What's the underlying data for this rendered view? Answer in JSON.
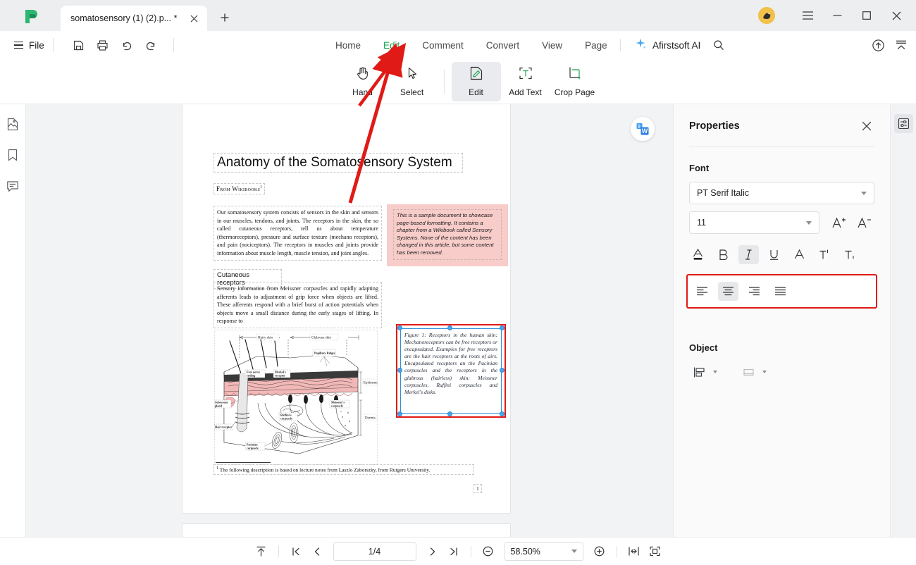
{
  "titlebar": {
    "logo_icon": "afirstsoft-logo-icon",
    "tab_title": "somatosensory (1) (2).p... *",
    "tab_close_icon": "close-icon",
    "new_tab_icon": "plus-icon",
    "avatar_icon": "user-avatar",
    "menu_icon": "hamburger-icon",
    "minimize_icon": "minimize-icon",
    "maximize_icon": "maximize-icon",
    "close_icon": "close-icon"
  },
  "menubar": {
    "file_label": "File",
    "quick_actions": [
      {
        "name": "save-as-button",
        "icon": "save-icon"
      },
      {
        "name": "print-button",
        "icon": "print-icon"
      },
      {
        "name": "undo-button",
        "icon": "undo-icon"
      },
      {
        "name": "redo-button",
        "icon": "redo-icon"
      }
    ],
    "tabs": [
      {
        "label": "Home",
        "active": false
      },
      {
        "label": "Edit",
        "active": true
      },
      {
        "label": "Comment",
        "active": false
      },
      {
        "label": "Convert",
        "active": false
      },
      {
        "label": "View",
        "active": false
      },
      {
        "label": "Page",
        "active": false
      }
    ],
    "ai_label": "Afirstsoft AI",
    "ai_icon": "sparkle-icon",
    "search_icon": "search-icon",
    "cloud_upload_icon": "cloud-upload-icon",
    "collapse_icon": "collapse-ribbon-icon",
    "accent_color": "#16a34a"
  },
  "ribbon": {
    "tools": [
      {
        "label": "Hand",
        "icon": "hand-icon",
        "active": false
      },
      {
        "label": "Select",
        "icon": "cursor-icon",
        "active": false
      },
      {
        "label": "Edit",
        "icon": "edit-page-icon",
        "active": true
      },
      {
        "label": "Add Text",
        "icon": "add-text-icon",
        "active": false
      },
      {
        "label": "Crop Page",
        "icon": "crop-page-icon",
        "active": false
      }
    ]
  },
  "left_rail": [
    {
      "name": "sidebar-thumbnails",
      "icon": "thumbnail-icon"
    },
    {
      "name": "sidebar-bookmarks",
      "icon": "bookmark-icon"
    },
    {
      "name": "sidebar-comments",
      "icon": "comment-icon"
    }
  ],
  "document": {
    "word_badge_icon": "convert-to-word-icon",
    "title": "Anatomy of the Somatosensory System",
    "from_line": "From Wikibooks",
    "from_sup": "1",
    "paragraph1": "Our somatosensory system consists of sensors in the skin and sensors in our muscles, tendons, and joints. The receptors in the skin, the so called cutaneous receptors, tell us about temperature (thermoreceptors), pressure and surface texture (mechano receptors), and pain (nociceptors). The receptors in muscles and joints provide information about muscle length, muscle tension, and joint angles.",
    "pink_note": "This is a sample document to showcase page-based formatting. It contains a chapter from a Wikibook called Sensory Systems. None of the content has been changed in this article, but some content has been removed.",
    "heading2": "Cutaneous receptors",
    "paragraph2": "Sensory information from Meissner corpuscles and rapidly adapting afferents leads to adjustment of grip force when objects are lifted. These afferents respond with a brief burst of action potentials when objects move a small distance during the early stages of lifting. In response to",
    "figure_caption": "Figure 1: Receptors in the human skin: Mechanoreceptors can be free receptors or encapsulated. Examples for free receptors are the hair receptors at the roots of airs. Encapsulated receptors an the Pacinian corpuscles and the receptors in the glabrous (hairless) skin: Meissner corpuscles, Ruffini corpuscles and Merkel's disks.",
    "figure_labels": {
      "hairy_skin": "Hairy skin",
      "glabrous_skin": "Glabrous skin",
      "papillary_ridges": "Papillary Ridges",
      "epidermis": "Epidermis",
      "dermis": "Dermis",
      "free_nerve": "Free nerve ending",
      "merkel": "Merkel's receptor",
      "sebaceous": "Sebaceous gland",
      "hair_receptor": "Hair receptor",
      "ruffini": "Ruffini corpuscle",
      "meissner": "Meissner's corpuscle",
      "pacinian": "Pacinian corpuscle"
    },
    "footnote": "The following description is based on lecture notes from Laszlo Zaborszky, from Rutgers University.",
    "footnote_sup": "1",
    "page_number": "1",
    "selection_border_color": "#e01a16",
    "selection_handle_color": "#4aa3e8"
  },
  "properties": {
    "title": "Properties",
    "close_icon": "close-icon",
    "font_section_label": "Font",
    "font_family_value": "PT Serif Italic",
    "font_size_value": "11",
    "increase_font_icon": "increase-font-size-icon",
    "decrease_font_icon": "decrease-font-size-icon",
    "format_buttons": [
      {
        "name": "font-color-button",
        "icon": "font-color-icon",
        "active": false
      },
      {
        "name": "bold-button",
        "icon": "bold-icon",
        "active": false
      },
      {
        "name": "italic-button",
        "icon": "italic-icon",
        "active": true
      },
      {
        "name": "underline-button",
        "icon": "underline-icon",
        "active": false
      },
      {
        "name": "strikethrough-button",
        "icon": "strikethrough-icon",
        "active": false
      },
      {
        "name": "superscript-button",
        "icon": "superscript-icon",
        "active": false
      },
      {
        "name": "subscript-button",
        "icon": "subscript-icon",
        "active": false
      }
    ],
    "align_buttons": [
      {
        "name": "align-left-button",
        "icon": "align-left-icon",
        "active": false
      },
      {
        "name": "align-center-button",
        "icon": "align-center-icon",
        "active": true
      },
      {
        "name": "align-right-button",
        "icon": "align-right-icon",
        "active": false
      },
      {
        "name": "align-justify-button",
        "icon": "align-justify-icon",
        "active": false
      }
    ],
    "align_highlight_color": "#e01a16",
    "object_section_label": "Object",
    "object_buttons": [
      {
        "name": "align-objects-button",
        "icon": "object-align-icon"
      },
      {
        "name": "object-order-button",
        "icon": "object-order-icon"
      }
    ],
    "panel_toggle_icon": "properties-panel-toggle-icon"
  },
  "statusbar": {
    "fit_top_icon": "scroll-to-top-icon",
    "first_page_icon": "first-page-icon",
    "prev_page_icon": "previous-page-icon",
    "page_indicator": "1/4",
    "next_page_icon": "next-page-icon",
    "last_page_icon": "last-page-icon",
    "zoom_out_icon": "zoom-out-icon",
    "zoom_value": "58.50%",
    "zoom_in_icon": "zoom-in-icon",
    "fit_width_icon": "fit-width-icon",
    "fit_page_icon": "fit-page-icon"
  }
}
